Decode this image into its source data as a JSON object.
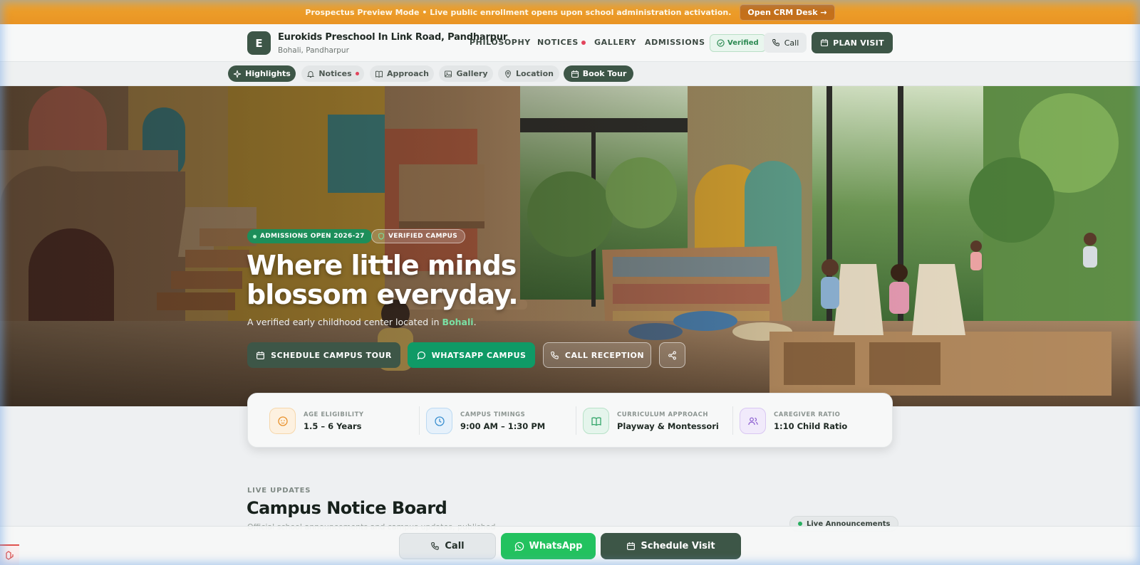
{
  "banner": {
    "message": "Prospectus Preview Mode • Live public enrollment opens upon school administration activation.",
    "crm_button": "Open CRM Desk →"
  },
  "header": {
    "logo_letter": "E",
    "school_name": "Eurokids Preschool In Link Road, Pandharpur",
    "location": "Bohali, Pandharpur",
    "nav": [
      "PHILOSOPHY",
      "NOTICES",
      "GALLERY",
      "ADMISSIONS"
    ],
    "verified_label": "Verified",
    "call_label": "Call",
    "plan_visit_label": "PLAN VISIT"
  },
  "subnav": {
    "items": [
      {
        "label": "Highlights",
        "icon": "sparkle-icon",
        "active": true
      },
      {
        "label": "Notices",
        "icon": "bell-icon",
        "active": false
      },
      {
        "label": "Approach",
        "icon": "book-icon",
        "active": false
      },
      {
        "label": "Gallery",
        "icon": "image-icon",
        "active": false
      },
      {
        "label": "Location",
        "icon": "map-pin-icon",
        "active": false
      },
      {
        "label": "Book Tour",
        "icon": "calendar-icon",
        "active": true
      }
    ]
  },
  "hero": {
    "badge_admissions": "ADMISSIONS OPEN 2026-27",
    "badge_verified": "VERIFIED CAMPUS",
    "title": "Where little minds blossom everyday.",
    "subtitle_prefix": "A verified early childhood center located in ",
    "subtitle_highlight": "Bohali",
    "subtitle_suffix": ".",
    "buttons": {
      "tour": "SCHEDULE CAMPUS TOUR",
      "whatsapp": "WHATSAPP CAMPUS",
      "call": "CALL RECEPTION"
    }
  },
  "facts": [
    {
      "label": "AGE ELIGIBILITY",
      "value": "1.5 – 6 Years",
      "icon": "baby-face-icon",
      "color": "#e8902a"
    },
    {
      "label": "CAMPUS TIMINGS",
      "value": "9:00 AM – 1:30 PM",
      "icon": "clock-icon",
      "color": "#3a8fd0"
    },
    {
      "label": "CURRICULUM APPROACH",
      "value": "Playway & Montessori",
      "icon": "open-book-icon",
      "color": "#27a060"
    },
    {
      "label": "CAREGIVER RATIO",
      "value": "1:10 Child Ratio",
      "icon": "users-icon",
      "color": "#8a5cd0"
    }
  ],
  "notices": {
    "eyebrow": "LIVE UPDATES",
    "title": "Campus Notice Board",
    "description": "Official school announcements and campus updates, published",
    "live_chip": "Live Announcements"
  },
  "bottom_bar": {
    "call": "Call",
    "whatsapp": "WhatsApp",
    "schedule": "Schedule Visit"
  },
  "colors": {
    "brand": "#3d5647",
    "banner": "#efa42d",
    "whatsapp": "#0f9a66",
    "notice_dot": "#e2445c"
  }
}
